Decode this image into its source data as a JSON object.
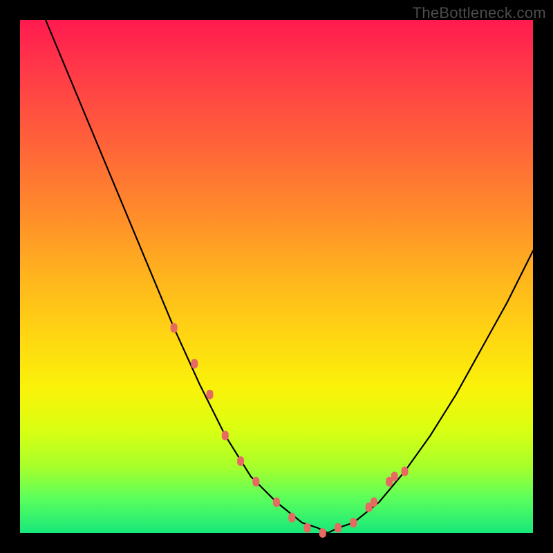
{
  "watermark": {
    "text": "TheBottleneck.com"
  },
  "colors": {
    "background": "#000000",
    "curve_stroke": "#000000",
    "marker_fill": "#e66a62",
    "gradient_top": "#ff1a4f",
    "gradient_bottom": "#17e87a"
  },
  "chart_data": {
    "type": "line",
    "title": "",
    "xlabel": "",
    "ylabel": "",
    "xlim": [
      0,
      100
    ],
    "ylim": [
      0,
      100
    ],
    "grid": false,
    "legend": false,
    "annotations": [
      "TheBottleneck.com"
    ],
    "series": [
      {
        "name": "bottleneck-curve",
        "x": [
          0,
          5,
          10,
          15,
          20,
          25,
          30,
          35,
          40,
          45,
          50,
          55,
          58,
          60,
          62,
          65,
          70,
          75,
          80,
          85,
          90,
          95,
          100
        ],
        "values": [
          120,
          100,
          88,
          76,
          64,
          52,
          40,
          29,
          19,
          11,
          6,
          2,
          1,
          0,
          1,
          2,
          6,
          12,
          19,
          27,
          36,
          45,
          55
        ]
      }
    ],
    "markers": {
      "name": "highlight-points",
      "x": [
        30,
        34,
        37,
        40,
        43,
        46,
        50,
        53,
        56,
        59,
        62,
        65,
        68,
        69,
        72,
        73,
        75
      ],
      "values": [
        40,
        33,
        27,
        19,
        14,
        10,
        6,
        3,
        1,
        0,
        1,
        2,
        5,
        6,
        10,
        11,
        12
      ]
    }
  }
}
